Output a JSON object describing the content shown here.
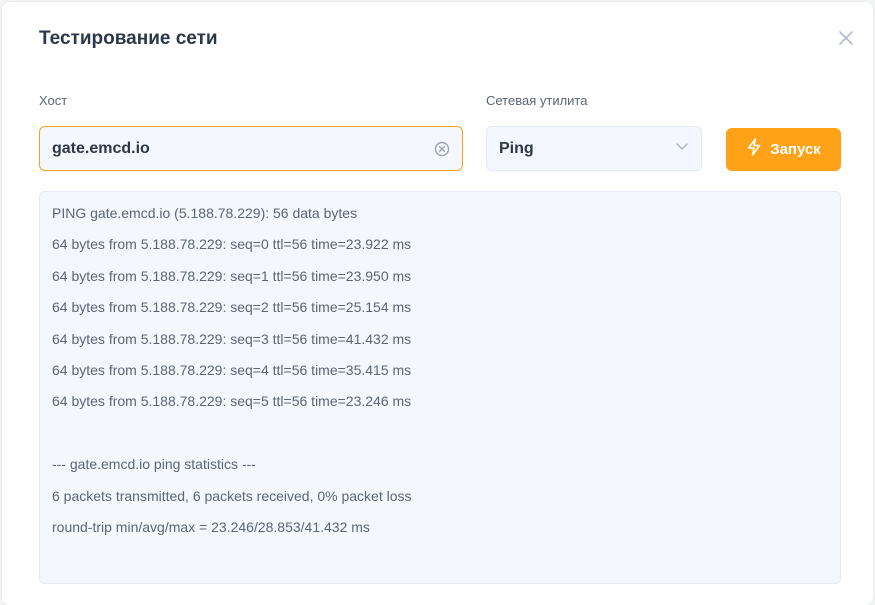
{
  "dialog": {
    "title": "Тестирование сети",
    "close_icon": "close-icon"
  },
  "host": {
    "label": "Хост",
    "value": "gate.emcd.io",
    "clear_icon": "clear-circle-icon"
  },
  "utility": {
    "label": "Сетевая утилита",
    "selected": "Ping",
    "chevron_icon": "chevron-down-icon"
  },
  "run_button": {
    "label": "Запуск",
    "icon": "lightning-icon",
    "color": "#ffa217"
  },
  "output": {
    "lines": [
      "PING gate.emcd.io (5.188.78.229): 56 data bytes",
      "64 bytes from 5.188.78.229: seq=0 ttl=56 time=23.922 ms",
      "64 bytes from 5.188.78.229: seq=1 ttl=56 time=23.950 ms",
      "64 bytes from 5.188.78.229: seq=2 ttl=56 time=25.154 ms",
      "64 bytes from 5.188.78.229: seq=3 ttl=56 time=41.432 ms",
      "64 bytes from 5.188.78.229: seq=4 ttl=56 time=35.415 ms",
      "64 bytes from 5.188.78.229: seq=5 ttl=56 time=23.246 ms",
      "",
      "--- gate.emcd.io ping statistics ---",
      "6 packets transmitted, 6 packets received, 0% packet loss",
      "round-trip min/avg/max = 23.246/28.853/41.432 ms"
    ]
  }
}
